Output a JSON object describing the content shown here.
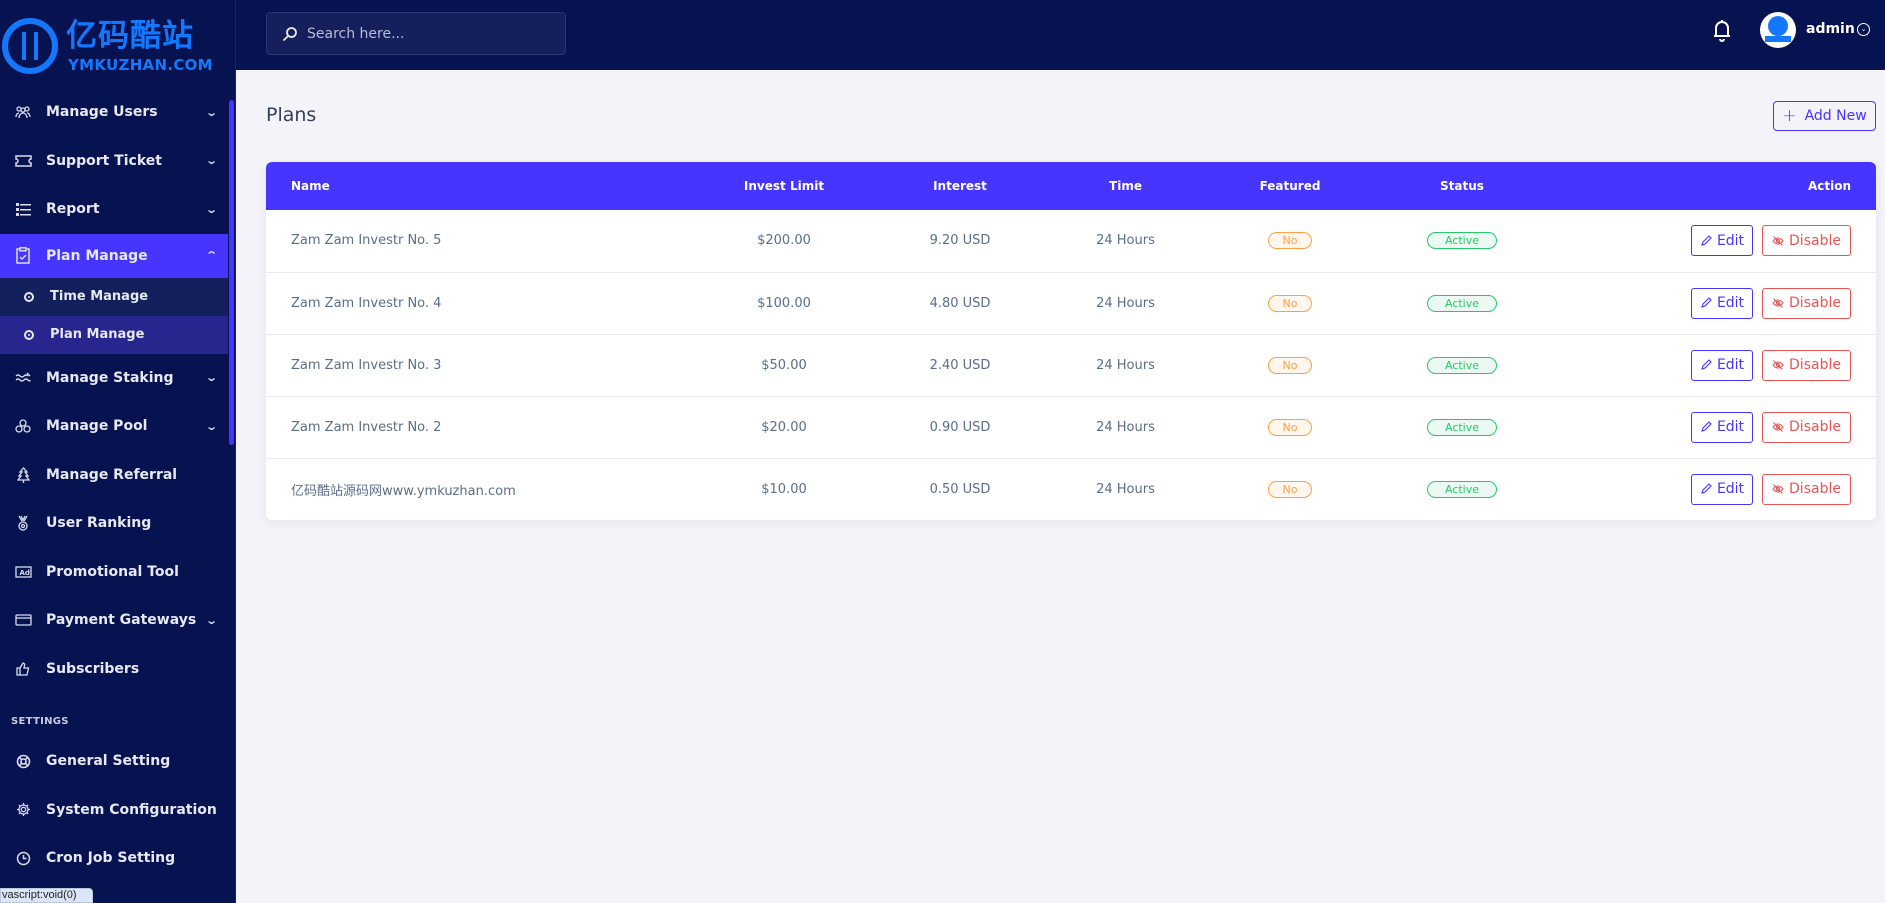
{
  "brand": {
    "name_cn": "亿码酷站",
    "name_en": "YMKUZHAN.COM",
    "accent": "#4634ff",
    "sidebar_bg": "#071251",
    "logo_color": "#1478ff"
  },
  "sidebar": {
    "items": [
      {
        "label": "Manage Users",
        "icon": "users-icon",
        "has_children": true
      },
      {
        "label": "Support Ticket",
        "icon": "ticket-icon",
        "has_children": true
      },
      {
        "label": "Report",
        "icon": "list-icon",
        "has_children": true
      },
      {
        "label": "Plan Manage",
        "icon": "clipboard-check-icon",
        "has_children": true,
        "expanded": true,
        "active": true,
        "children": [
          {
            "label": "Time Manage",
            "active": false
          },
          {
            "label": "Plan Manage",
            "active": true
          }
        ]
      },
      {
        "label": "Manage Staking",
        "icon": "water-icon",
        "has_children": true
      },
      {
        "label": "Manage Pool",
        "icon": "cubes-icon",
        "has_children": true
      },
      {
        "label": "Manage Referral",
        "icon": "tree-icon",
        "has_children": false
      },
      {
        "label": "User Ranking",
        "icon": "medal-icon",
        "has_children": false
      },
      {
        "label": "Promotional Tool",
        "icon": "ad-icon",
        "has_children": false
      },
      {
        "label": "Payment Gateways",
        "icon": "credit-card-icon",
        "has_children": true
      },
      {
        "label": "Subscribers",
        "icon": "thumbs-up-icon",
        "has_children": false
      }
    ],
    "settings_title": "SETTINGS",
    "settings_items": [
      {
        "label": "General Setting",
        "icon": "life-ring-icon"
      },
      {
        "label": "System Configuration",
        "icon": "gear-icon"
      },
      {
        "label": "Cron Job Setting",
        "icon": "clock-icon"
      }
    ]
  },
  "topbar": {
    "search_placeholder": "Search here...",
    "username": "admin"
  },
  "page": {
    "title": "Plans",
    "add_button": "Add New"
  },
  "table": {
    "columns": [
      "Name",
      "Invest Limit",
      "Interest",
      "Time",
      "Featured",
      "Status",
      "Action"
    ],
    "rows": [
      {
        "name": "Zam Zam Investr No. 5",
        "invest_limit": "$200.00",
        "interest": "9.20 USD",
        "time": "24 Hours",
        "featured": "No",
        "status": "Active"
      },
      {
        "name": "Zam Zam Investr No. 4",
        "invest_limit": "$100.00",
        "interest": "4.80 USD",
        "time": "24 Hours",
        "featured": "No",
        "status": "Active"
      },
      {
        "name": "Zam Zam Investr No. 3",
        "invest_limit": "$50.00",
        "interest": "2.40 USD",
        "time": "24 Hours",
        "featured": "No",
        "status": "Active"
      },
      {
        "name": "Zam Zam Investr No. 2",
        "invest_limit": "$20.00",
        "interest": "0.90 USD",
        "time": "24 Hours",
        "featured": "No",
        "status": "Active"
      },
      {
        "name": "亿码酷站源码网www.ymkuzhan.com",
        "invest_limit": "$10.00",
        "interest": "0.50 USD",
        "time": "24 Hours",
        "featured": "No",
        "status": "Active"
      }
    ],
    "actions": {
      "edit": "Edit",
      "disable": "Disable"
    }
  },
  "statusbar": {
    "link_preview": "vascript:void(0)"
  }
}
